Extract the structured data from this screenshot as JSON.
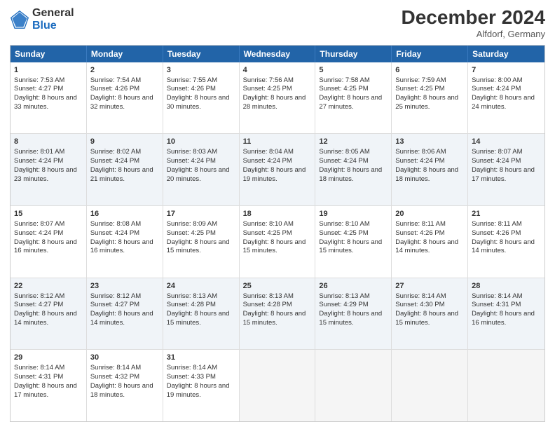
{
  "header": {
    "logo_general": "General",
    "logo_blue": "Blue",
    "month_title": "December 2024",
    "location": "Alfdorf, Germany"
  },
  "days_of_week": [
    "Sunday",
    "Monday",
    "Tuesday",
    "Wednesday",
    "Thursday",
    "Friday",
    "Saturday"
  ],
  "weeks": [
    [
      {
        "day": "1",
        "sunrise": "Sunrise: 7:53 AM",
        "sunset": "Sunset: 4:27 PM",
        "daylight": "Daylight: 8 hours and 33 minutes."
      },
      {
        "day": "2",
        "sunrise": "Sunrise: 7:54 AM",
        "sunset": "Sunset: 4:26 PM",
        "daylight": "Daylight: 8 hours and 32 minutes."
      },
      {
        "day": "3",
        "sunrise": "Sunrise: 7:55 AM",
        "sunset": "Sunset: 4:26 PM",
        "daylight": "Daylight: 8 hours and 30 minutes."
      },
      {
        "day": "4",
        "sunrise": "Sunrise: 7:56 AM",
        "sunset": "Sunset: 4:25 PM",
        "daylight": "Daylight: 8 hours and 28 minutes."
      },
      {
        "day": "5",
        "sunrise": "Sunrise: 7:58 AM",
        "sunset": "Sunset: 4:25 PM",
        "daylight": "Daylight: 8 hours and 27 minutes."
      },
      {
        "day": "6",
        "sunrise": "Sunrise: 7:59 AM",
        "sunset": "Sunset: 4:25 PM",
        "daylight": "Daylight: 8 hours and 25 minutes."
      },
      {
        "day": "7",
        "sunrise": "Sunrise: 8:00 AM",
        "sunset": "Sunset: 4:24 PM",
        "daylight": "Daylight: 8 hours and 24 minutes."
      }
    ],
    [
      {
        "day": "8",
        "sunrise": "Sunrise: 8:01 AM",
        "sunset": "Sunset: 4:24 PM",
        "daylight": "Daylight: 8 hours and 23 minutes."
      },
      {
        "day": "9",
        "sunrise": "Sunrise: 8:02 AM",
        "sunset": "Sunset: 4:24 PM",
        "daylight": "Daylight: 8 hours and 21 minutes."
      },
      {
        "day": "10",
        "sunrise": "Sunrise: 8:03 AM",
        "sunset": "Sunset: 4:24 PM",
        "daylight": "Daylight: 8 hours and 20 minutes."
      },
      {
        "day": "11",
        "sunrise": "Sunrise: 8:04 AM",
        "sunset": "Sunset: 4:24 PM",
        "daylight": "Daylight: 8 hours and 19 minutes."
      },
      {
        "day": "12",
        "sunrise": "Sunrise: 8:05 AM",
        "sunset": "Sunset: 4:24 PM",
        "daylight": "Daylight: 8 hours and 18 minutes."
      },
      {
        "day": "13",
        "sunrise": "Sunrise: 8:06 AM",
        "sunset": "Sunset: 4:24 PM",
        "daylight": "Daylight: 8 hours and 18 minutes."
      },
      {
        "day": "14",
        "sunrise": "Sunrise: 8:07 AM",
        "sunset": "Sunset: 4:24 PM",
        "daylight": "Daylight: 8 hours and 17 minutes."
      }
    ],
    [
      {
        "day": "15",
        "sunrise": "Sunrise: 8:07 AM",
        "sunset": "Sunset: 4:24 PM",
        "daylight": "Daylight: 8 hours and 16 minutes."
      },
      {
        "day": "16",
        "sunrise": "Sunrise: 8:08 AM",
        "sunset": "Sunset: 4:24 PM",
        "daylight": "Daylight: 8 hours and 16 minutes."
      },
      {
        "day": "17",
        "sunrise": "Sunrise: 8:09 AM",
        "sunset": "Sunset: 4:25 PM",
        "daylight": "Daylight: 8 hours and 15 minutes."
      },
      {
        "day": "18",
        "sunrise": "Sunrise: 8:10 AM",
        "sunset": "Sunset: 4:25 PM",
        "daylight": "Daylight: 8 hours and 15 minutes."
      },
      {
        "day": "19",
        "sunrise": "Sunrise: 8:10 AM",
        "sunset": "Sunset: 4:25 PM",
        "daylight": "Daylight: 8 hours and 15 minutes."
      },
      {
        "day": "20",
        "sunrise": "Sunrise: 8:11 AM",
        "sunset": "Sunset: 4:26 PM",
        "daylight": "Daylight: 8 hours and 14 minutes."
      },
      {
        "day": "21",
        "sunrise": "Sunrise: 8:11 AM",
        "sunset": "Sunset: 4:26 PM",
        "daylight": "Daylight: 8 hours and 14 minutes."
      }
    ],
    [
      {
        "day": "22",
        "sunrise": "Sunrise: 8:12 AM",
        "sunset": "Sunset: 4:27 PM",
        "daylight": "Daylight: 8 hours and 14 minutes."
      },
      {
        "day": "23",
        "sunrise": "Sunrise: 8:12 AM",
        "sunset": "Sunset: 4:27 PM",
        "daylight": "Daylight: 8 hours and 14 minutes."
      },
      {
        "day": "24",
        "sunrise": "Sunrise: 8:13 AM",
        "sunset": "Sunset: 4:28 PM",
        "daylight": "Daylight: 8 hours and 15 minutes."
      },
      {
        "day": "25",
        "sunrise": "Sunrise: 8:13 AM",
        "sunset": "Sunset: 4:28 PM",
        "daylight": "Daylight: 8 hours and 15 minutes."
      },
      {
        "day": "26",
        "sunrise": "Sunrise: 8:13 AM",
        "sunset": "Sunset: 4:29 PM",
        "daylight": "Daylight: 8 hours and 15 minutes."
      },
      {
        "day": "27",
        "sunrise": "Sunrise: 8:14 AM",
        "sunset": "Sunset: 4:30 PM",
        "daylight": "Daylight: 8 hours and 15 minutes."
      },
      {
        "day": "28",
        "sunrise": "Sunrise: 8:14 AM",
        "sunset": "Sunset: 4:31 PM",
        "daylight": "Daylight: 8 hours and 16 minutes."
      }
    ],
    [
      {
        "day": "29",
        "sunrise": "Sunrise: 8:14 AM",
        "sunset": "Sunset: 4:31 PM",
        "daylight": "Daylight: 8 hours and 17 minutes."
      },
      {
        "day": "30",
        "sunrise": "Sunrise: 8:14 AM",
        "sunset": "Sunset: 4:32 PM",
        "daylight": "Daylight: 8 hours and 18 minutes."
      },
      {
        "day": "31",
        "sunrise": "Sunrise: 8:14 AM",
        "sunset": "Sunset: 4:33 PM",
        "daylight": "Daylight: 8 hours and 19 minutes."
      },
      null,
      null,
      null,
      null
    ]
  ]
}
